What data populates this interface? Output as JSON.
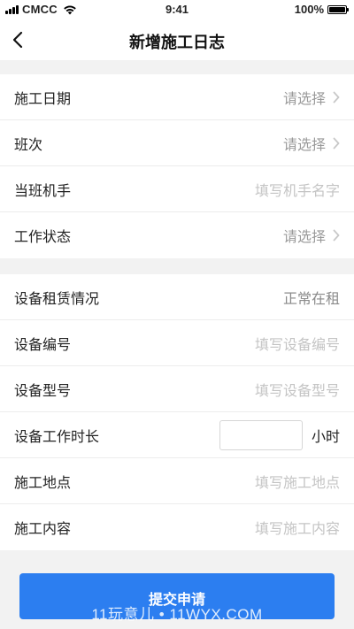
{
  "status_bar": {
    "carrier": "CMCC",
    "time": "9:41",
    "battery": "100%"
  },
  "nav": {
    "title": "新增施工日志"
  },
  "group1": [
    {
      "label": "施工日期",
      "value": "请选择",
      "kind": "select"
    },
    {
      "label": "班次",
      "value": "请选择",
      "kind": "select"
    },
    {
      "label": "当班机手",
      "value": "填写机手名字",
      "kind": "input"
    },
    {
      "label": "工作状态",
      "value": "请选择",
      "kind": "select"
    }
  ],
  "group2": [
    {
      "label": "设备租赁情况",
      "value": "正常在租",
      "kind": "readonly"
    },
    {
      "label": "设备编号",
      "value": "填写设备编号",
      "kind": "input"
    },
    {
      "label": "设备型号",
      "value": "填写设备型号",
      "kind": "input"
    },
    {
      "label": "设备工作时长",
      "unit": "小时",
      "kind": "hours"
    },
    {
      "label": "施工地点",
      "value": "填写施工地点",
      "kind": "input"
    },
    {
      "label": "施工内容",
      "value": "填写施工内容",
      "kind": "input"
    }
  ],
  "submit": {
    "label": "提交申请"
  },
  "watermark": "11玩意儿 • 11WYX.COM",
  "colors": {
    "primary": "#2c7ef0",
    "page_bg": "#f2f2f2"
  }
}
